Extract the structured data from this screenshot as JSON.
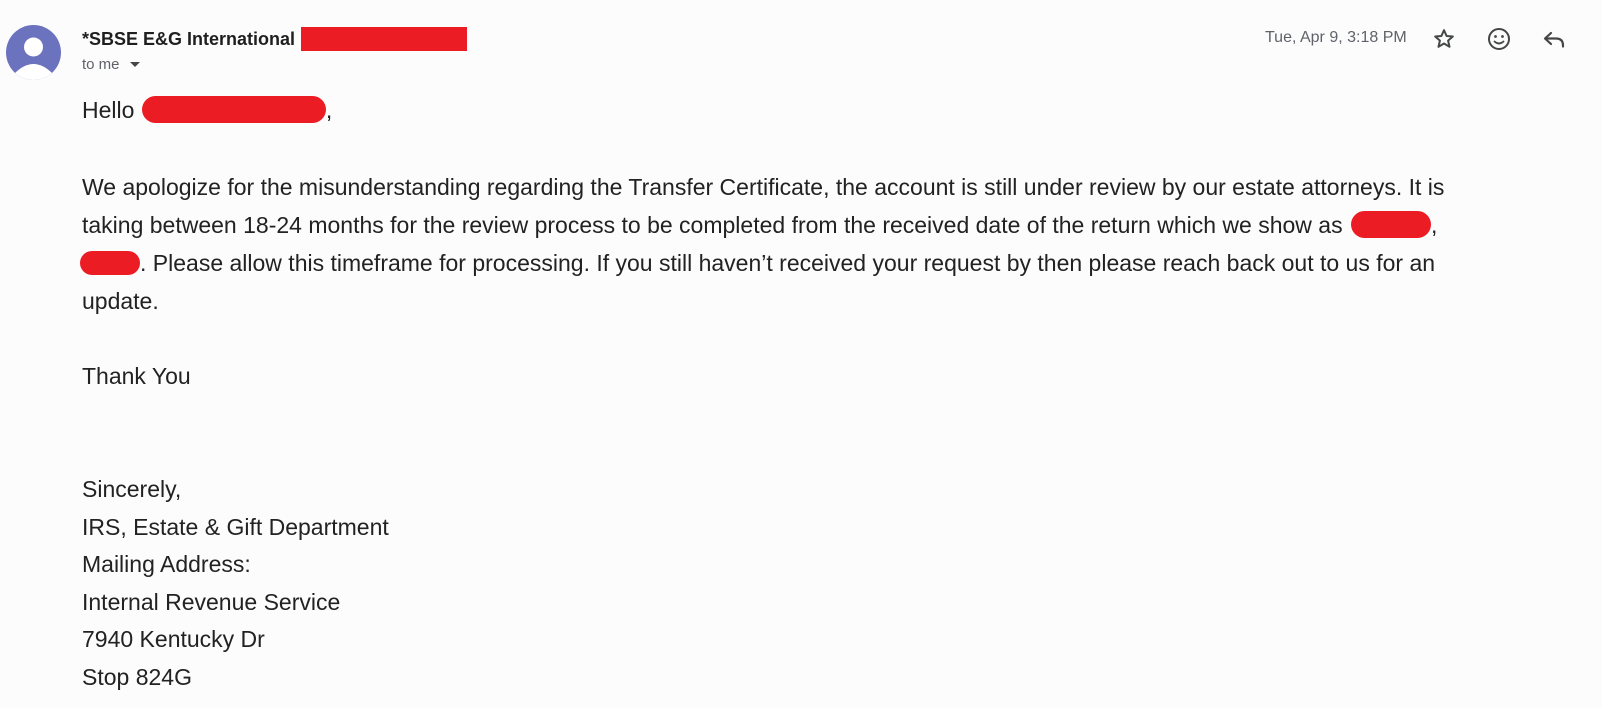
{
  "header": {
    "sender_name": "*SBSE E&G International",
    "recipient_label": "to me",
    "timestamp": "Tue, Apr 9, 3:18 PM",
    "icons": [
      "avatar",
      "star-icon",
      "emoji-reaction-icon",
      "reply-icon",
      "chevron-down-icon"
    ]
  },
  "body": {
    "greeting_prefix": "Hello",
    "greeting_suffix": ",",
    "paragraph_line1": "We apologize for the misunderstanding regarding the Transfer Certificate, the account is still under review by our estate attorneys. It is",
    "paragraph_line2": "taking between 18-24 months for the review process to be completed from the received date of the return which we show as",
    "paragraph_line2_suffix": ",",
    "paragraph_line3": ". Please allow this timeframe for processing. If you still haven’t received your request by then please reach back out to us for an",
    "paragraph_line4": "update.",
    "thanks": "Thank You",
    "signature": [
      "Sincerely,",
      "IRS, Estate & Gift Department",
      "Mailing Address:",
      "Internal Revenue Service",
      "7940 Kentucky Dr",
      "Stop 824G"
    ]
  },
  "colors": {
    "redaction": "#ec1c24",
    "avatar": "#6b73bf",
    "background": "#fdfcfd"
  }
}
